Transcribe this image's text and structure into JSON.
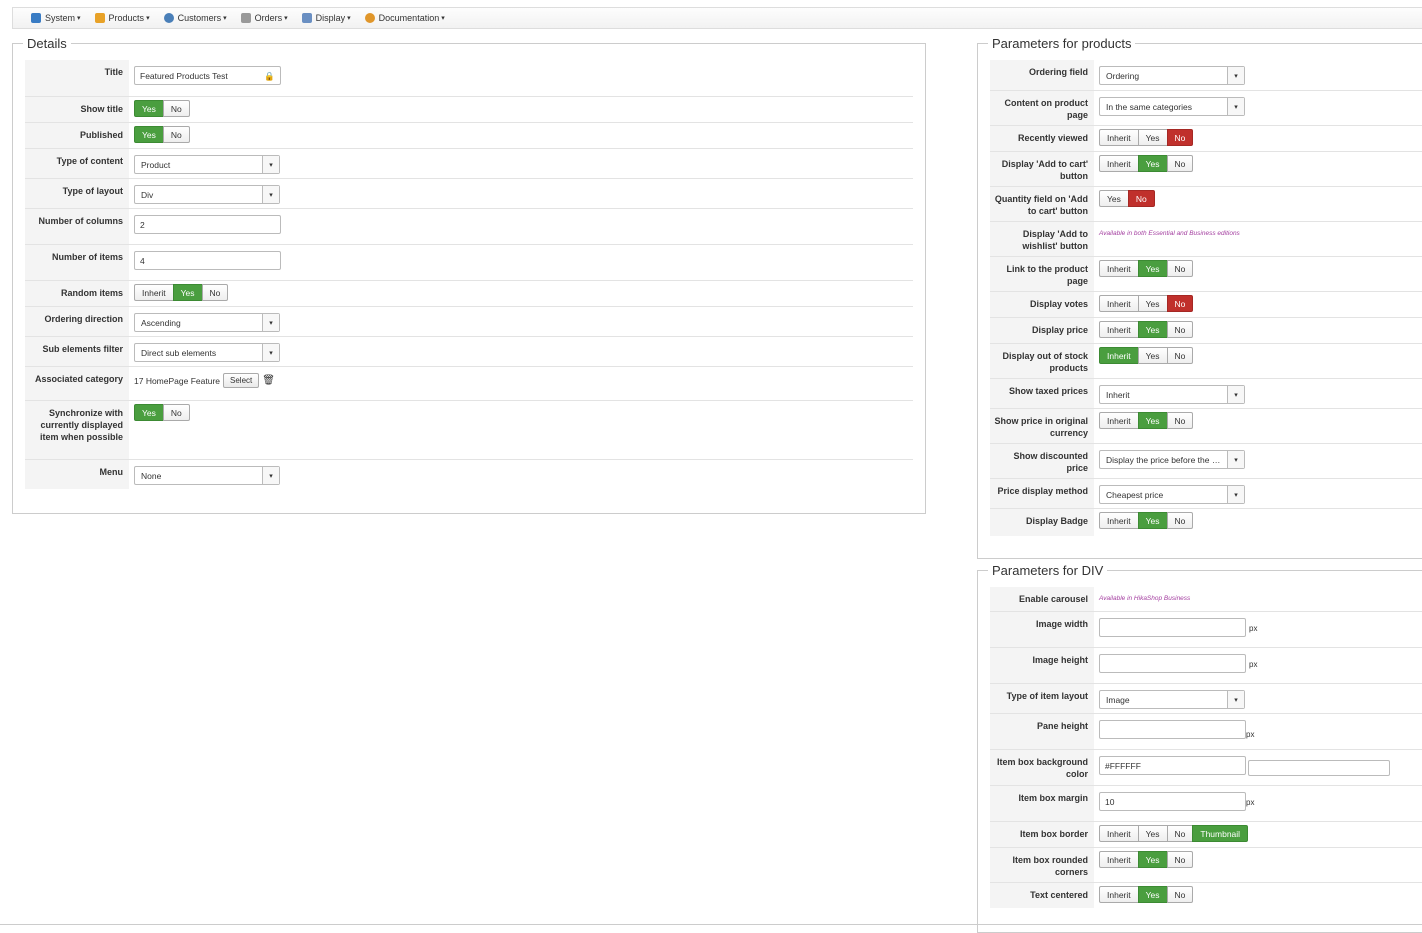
{
  "menu": [
    {
      "label": "System",
      "icon": "tools-icon",
      "color": "#3a7cc4"
    },
    {
      "label": "Products",
      "icon": "products-icon",
      "color": "#e8a228"
    },
    {
      "label": "Customers",
      "icon": "customers-icon",
      "color": "#4a7fb8"
    },
    {
      "label": "Orders",
      "icon": "orders-icon",
      "color": "#999999"
    },
    {
      "label": "Display",
      "icon": "display-icon",
      "color": "#6a8fc2"
    },
    {
      "label": "Documentation",
      "icon": "documentation-icon",
      "color": "#e0962a"
    }
  ],
  "details": {
    "legend": "Details",
    "title_label": "Title",
    "title_value": "Featured Products Test",
    "show_title_label": "Show title",
    "published_label": "Published",
    "type_content_label": "Type of content",
    "type_content_value": "Product",
    "type_layout_label": "Type of layout",
    "type_layout_value": "Div",
    "num_columns_label": "Number of columns",
    "num_columns_value": "2",
    "num_items_label": "Number of items",
    "num_items_value": "4",
    "random_items_label": "Random items",
    "ordering_dir_label": "Ordering direction",
    "ordering_dir_value": "Ascending",
    "sub_filter_label": "Sub elements filter",
    "sub_filter_value": "Direct sub elements",
    "assoc_cat_label": "Associated category",
    "assoc_cat_value": "17 HomePage Feature",
    "select_label": "Select",
    "sync_label": "Synchronize with currently displayed item when possible",
    "menu_label": "Menu",
    "menu_value": "None"
  },
  "btn": {
    "inherit": "Inherit",
    "yes": "Yes",
    "no": "No",
    "thumbnail": "Thumbnail"
  },
  "products": {
    "legend": "Parameters for products",
    "ordering_field_label": "Ordering field",
    "ordering_field_value": "Ordering",
    "content_label": "Content on product page",
    "content_value": "In the same categories",
    "recent_label": "Recently viewed",
    "add_cart_label": "Display 'Add to cart' button",
    "qty_label": "Quantity field on 'Add to cart' button",
    "wishlist_label": "Display 'Add to wishlist' button",
    "wishlist_note": "Available in both Essential and Business editions",
    "link_label": "Link to the product page",
    "votes_label": "Display votes",
    "price_label": "Display price",
    "oos_label": "Display out of stock products",
    "taxed_label": "Show taxed prices",
    "taxed_value": "Inherit",
    "orig_cur_label": "Show price in original currency",
    "discount_label": "Show discounted price",
    "discount_value": "Display the price before the …",
    "method_label": "Price display method",
    "method_value": "Cheapest price",
    "badge_label": "Display Badge"
  },
  "div": {
    "legend": "Parameters for DIV",
    "carousel_label": "Enable carousel",
    "carousel_note": "Available in HikaShop Business",
    "img_w_label": "Image width",
    "img_h_label": "Image height",
    "item_layout_label": "Type of item layout",
    "item_layout_value": "Image",
    "pane_label": "Pane height",
    "bg_label": "Item box background color",
    "bg_value": "#FFFFFF",
    "margin_label": "Item box margin",
    "margin_value": "10",
    "border_label": "Item box border",
    "rounded_label": "Item box rounded corners",
    "centered_label": "Text centered",
    "px": "px"
  }
}
